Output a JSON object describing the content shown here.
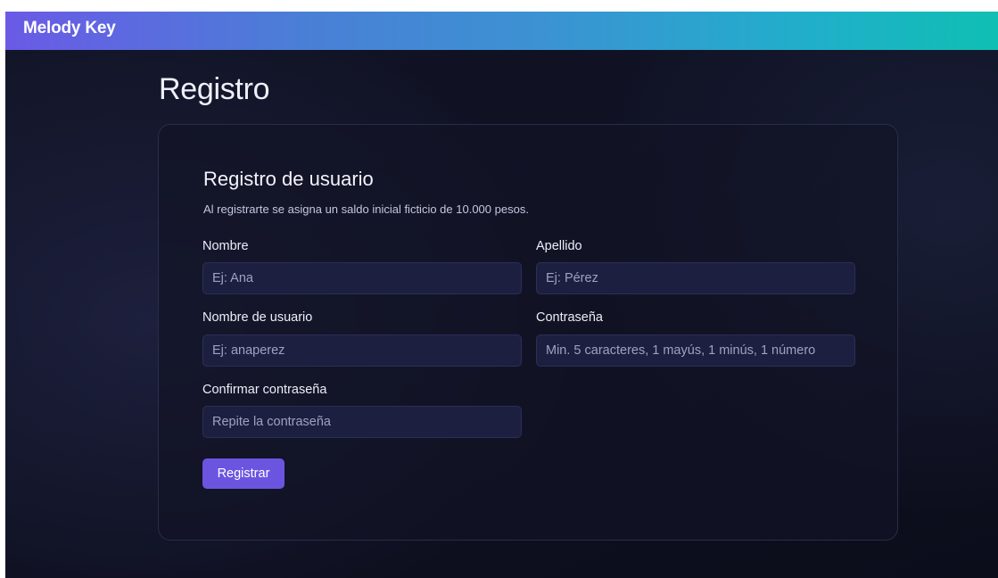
{
  "navbar": {
    "brand": "Melody Key"
  },
  "page": {
    "title": "Registro"
  },
  "form": {
    "title": "Registro de usuario",
    "subtitle": "Al registrarte se asigna un saldo inicial ficticio de 10.000 pesos.",
    "fields": {
      "nombre": {
        "label": "Nombre",
        "placeholder": "Ej: Ana",
        "value": ""
      },
      "apellido": {
        "label": "Apellido",
        "placeholder": "Ej: Pérez",
        "value": ""
      },
      "usuario": {
        "label": "Nombre de usuario",
        "placeholder": "Ej: anaperez",
        "value": ""
      },
      "contrasena": {
        "label": "Contraseña",
        "placeholder": "Min. 5 caracteres, 1 mayús, 1 minús, 1 número",
        "value": ""
      },
      "confirmar": {
        "label": "Confirmar contraseña",
        "placeholder": "Repite la contraseña",
        "value": ""
      }
    },
    "submit_label": "Registrar"
  },
  "colors": {
    "navbar_gradient_start": "#6a5ae6",
    "navbar_gradient_end": "#0fbfb3",
    "background": "#0f1122",
    "card_border": "#2a2d48",
    "input_background": "#1c1f3f",
    "button_accent": "#6b55e0"
  }
}
